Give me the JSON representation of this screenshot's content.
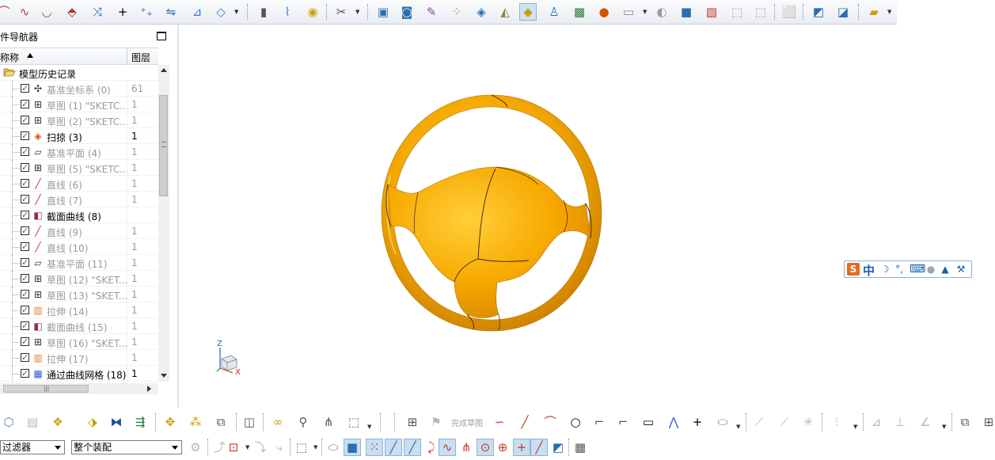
{
  "navigator": {
    "title": "件导航器",
    "columns": {
      "name": "称称",
      "layer": "图层"
    },
    "root_label": "模型历史记录",
    "features": [
      {
        "name": "基准坐标系 (0)",
        "layer": "61",
        "dim": true,
        "icon": "datum-csys-icon",
        "glyph": "✣"
      },
      {
        "name": "草图 (1) \"SKETC...",
        "layer": "1",
        "dim": true,
        "icon": "sketch-icon",
        "glyph": "⊞"
      },
      {
        "name": "草图 (2) \"SKETC...",
        "layer": "1",
        "dim": true,
        "icon": "sketch-icon",
        "glyph": "⊞"
      },
      {
        "name": "扫掠 (3)",
        "layer": "1",
        "dim": false,
        "icon": "swept-icon",
        "glyph": "◈"
      },
      {
        "name": "基准平面 (4)",
        "layer": "1",
        "dim": true,
        "icon": "datum-plane-icon",
        "glyph": "▱"
      },
      {
        "name": "草图 (5) \"SKETC...",
        "layer": "1",
        "dim": true,
        "icon": "sketch-icon",
        "glyph": "⊞"
      },
      {
        "name": "直线 (6)",
        "layer": "1",
        "dim": true,
        "icon": "line-icon",
        "glyph": "╱"
      },
      {
        "name": "直线 (7)",
        "layer": "1",
        "dim": true,
        "icon": "line-icon",
        "glyph": "╱"
      },
      {
        "name": "截面曲线 (8)",
        "layer": "",
        "dim": false,
        "icon": "section-curve-icon",
        "glyph": "◧"
      },
      {
        "name": "直线 (9)",
        "layer": "1",
        "dim": true,
        "icon": "line-icon",
        "glyph": "╱"
      },
      {
        "name": "直线 (10)",
        "layer": "1",
        "dim": true,
        "icon": "line-icon",
        "glyph": "╱"
      },
      {
        "name": "基准平面 (11)",
        "layer": "1",
        "dim": true,
        "icon": "datum-plane-icon",
        "glyph": "▱"
      },
      {
        "name": "草图 (12) \"SKET...",
        "layer": "1",
        "dim": true,
        "icon": "sketch-icon",
        "glyph": "⊞"
      },
      {
        "name": "草图 (13) \"SKET...",
        "layer": "1",
        "dim": true,
        "icon": "sketch-icon",
        "glyph": "⊞"
      },
      {
        "name": "拉伸 (14)",
        "layer": "1",
        "dim": true,
        "icon": "extrude-icon",
        "glyph": "▥"
      },
      {
        "name": "截面曲线 (15)",
        "layer": "1",
        "dim": true,
        "icon": "section-curve-icon",
        "glyph": "◧"
      },
      {
        "name": "草图 (16) \"SKET...",
        "layer": "1",
        "dim": true,
        "icon": "sketch-icon",
        "glyph": "⊞"
      },
      {
        "name": "拉伸 (17)",
        "layer": "1",
        "dim": true,
        "icon": "extrude-icon",
        "glyph": "▥"
      },
      {
        "name": "通过曲线网格 (18)",
        "layer": "1",
        "dim": false,
        "icon": "through-curve-mesh-icon",
        "glyph": "▦"
      }
    ]
  },
  "triad": {
    "z_label": "Z",
    "x_label": "X"
  },
  "ime": {
    "logo": "S",
    "mode": "中",
    "tools": [
      "moon-icon",
      "punctuation-icon",
      "keyboard-icon",
      "user-icon",
      "skin-icon",
      "wrench-icon"
    ]
  },
  "bottom": {
    "finish_sketch": "完成草图",
    "filter_select": "过滤器",
    "assembly_select": "整个装配"
  },
  "colors": {
    "model": "#f5a800",
    "model_shade": "#d88a00",
    "accent": "#cfe3f3"
  }
}
